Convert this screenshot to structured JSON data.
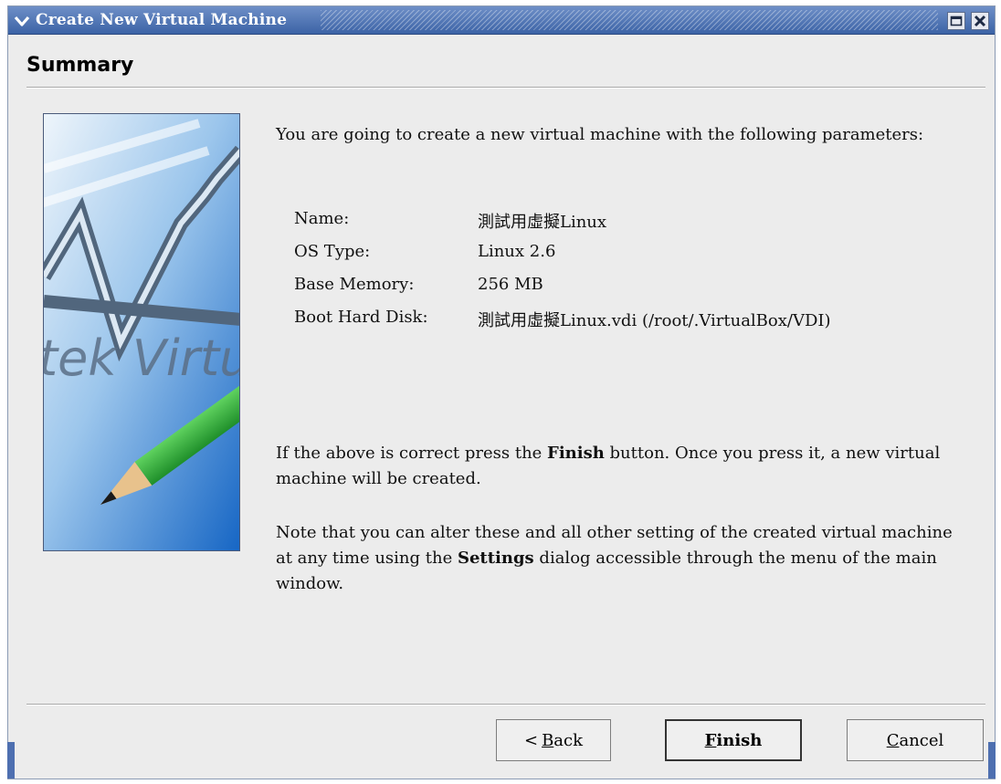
{
  "window": {
    "title": "Create New Virtual Machine",
    "colors": {
      "titlebar": "#3c63a6",
      "accent": "#2f78c9"
    }
  },
  "page": {
    "header": "Summary"
  },
  "banner": {
    "text": "tek Virtua"
  },
  "content": {
    "intro": "You are going to create a new virtual machine with the following parameters:",
    "params": [
      {
        "label": "Name:",
        "value": "測試用虛擬Linux"
      },
      {
        "label": "OS Type:",
        "value": "Linux 2.6"
      },
      {
        "label": "Base Memory:",
        "value": "256 MB"
      },
      {
        "label": "Boot Hard Disk:",
        "value": "測試用虛擬Linux.vdi (/root/.VirtualBox/VDI)"
      }
    ],
    "confirm": {
      "pre": "If the above is correct press the ",
      "bold": "Finish",
      "post": " button. Once you press it, a new virtual machine will be created."
    },
    "note": {
      "pre": "Note that you can alter these and all other setting of the created virtual machine at any time using the ",
      "bold": "Settings",
      "post": " dialog accessible through the menu of the main window."
    }
  },
  "buttons": {
    "back": {
      "arrow": "<",
      "mnemonic": "B",
      "rest": "ack"
    },
    "finish": {
      "mnemonic": "F",
      "rest": "inish"
    },
    "cancel": {
      "mnemonic": "C",
      "rest": "ancel"
    }
  },
  "icons": {
    "window_menu": "chevron-down-icon",
    "maximize": "maximize-icon",
    "close": "close-icon"
  }
}
